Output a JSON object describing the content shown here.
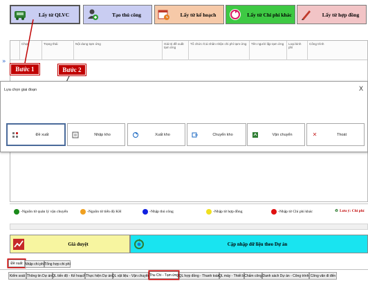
{
  "toolbar": {
    "btn1": {
      "label": "Lấy từ QLVC",
      "color": "#c9cdf2"
    },
    "btn2": {
      "label": "Tạo thủ công",
      "color": "#c9cdf2"
    },
    "btn3": {
      "label": "Lấy từ kế hoạch",
      "color": "#f6c9a8"
    },
    "btn4": {
      "label": "Lấy từ Chi phí khác",
      "color": "#3ec944"
    },
    "btn5": {
      "label": "Lấy từ hợp đồng",
      "color": "#f2c4c6"
    }
  },
  "grid": {
    "columns": [
      "Chọn",
      "Trạng thái",
      "Nội dung tạm ứng",
      "Giá trị đề xuất tạm ứng",
      "Tổ chức /Cá nhân nhận chi phí tạm ứng",
      "Tên người lập tạm ứng",
      "Loại kinh phí",
      "Công trình"
    ]
  },
  "callouts": {
    "step1": "Bước 1",
    "step2": "Bước 2"
  },
  "dialog": {
    "title": "Lựa chọn giai đoạn",
    "close": "X",
    "options": [
      {
        "label": "Đề xuất",
        "icon": "propose-icon"
      },
      {
        "label": "Nhập kho",
        "icon": "import-icon"
      },
      {
        "label": "Xuất kho",
        "icon": "export-icon"
      },
      {
        "label": "Chuyển kho",
        "icon": "transfer-icon"
      },
      {
        "label": "Vận chuyển",
        "icon": "transport-icon"
      },
      {
        "label": "Thoát",
        "icon": "exit-icon"
      }
    ]
  },
  "legend": {
    "items": [
      {
        "label": "-Nguồn từ quản lý vận chuyển",
        "color": "#1a8a1a"
      },
      {
        "label": "-Nguồn từ tiến độ KH",
        "color": "#f0a020"
      },
      {
        "label": "-Nhập thủ công",
        "color": "#1020e0"
      },
      {
        "label": "-Nhập từ hợp đồng",
        "color": "#f0e020"
      },
      {
        "label": "-Nhập từ Chi phí khác",
        "color": "#e01010"
      }
    ],
    "note": "Lưu ý: Chi phí"
  },
  "actions": {
    "approve": {
      "label": "Giá duyệt",
      "color": "#f7f5a0"
    },
    "update": {
      "label": "Cập nhập dữ liệu theo Dự án",
      "color": "#19e4f0"
    }
  },
  "subtabs": [
    "Đề xuất",
    "Nhập chi phí",
    "Tổng hợp chi phí"
  ],
  "moduletabs": [
    "Kiểm soát",
    "Thông tin Dự án",
    "QL tiến độ - Kế hoạch",
    "Thực hiện Dự án",
    "QL vật liệu - Vận chuyển",
    "Thu Chi - Tạm ứng",
    "QL hợp đồng - Thanh toán",
    "QL máy - Thiết bị",
    "Chấm công",
    "Danh sách Dự án - Công trình",
    "Công văn đi đến"
  ]
}
